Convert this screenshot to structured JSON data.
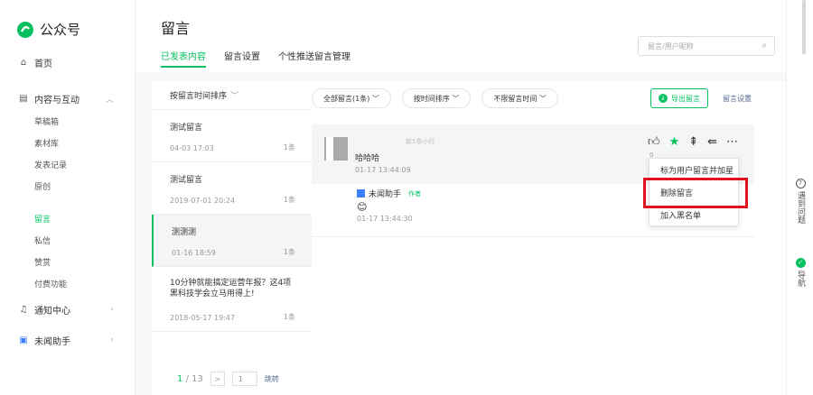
{
  "app": {
    "name": "公众号"
  },
  "sidebar": {
    "home": "首页",
    "content_group": "内容与互动",
    "content_items": [
      "草稿箱",
      "素材库",
      "发表记录",
      "原创"
    ],
    "interaction_items": [
      "留言",
      "私信",
      "赞赏",
      "付费功能"
    ],
    "notice": "通知中心",
    "assistant": "未闻助手"
  },
  "header": {
    "title": "留言",
    "tabs": [
      "已发表内容",
      "留言设置",
      "个性推送留言管理"
    ],
    "search_placeholder": "留言/用户昵称"
  },
  "list": {
    "sort_label": "按留言时间排序",
    "items": [
      {
        "title": "测试留言",
        "date": "04-03 17:03",
        "count": "1条"
      },
      {
        "title": "测试留言",
        "date": "2019-07-01 20:24",
        "count": "1条"
      },
      {
        "title": "测测测",
        "date": "01-16 18:59",
        "count": "1条"
      },
      {
        "title": "10分钟就能搞定运营年报？这4项黑科技学会立马用得上!",
        "date": "2018-05-17 19:47",
        "count": "1条"
      }
    ],
    "pager": {
      "current": "1",
      "total": "/ 13",
      "next": ">",
      "input": "1",
      "jump": "跳转"
    }
  },
  "detail": {
    "filters": [
      "全部留言(1条)",
      "按时间排序",
      "不限留言时间"
    ],
    "export": "导出留言",
    "settings": "留言设置",
    "comment": {
      "nickname": "新1条小行",
      "text": "哈哈哈",
      "time": "01-17 13:44:09",
      "zero": "0"
    },
    "reply": {
      "name": "未闻助手",
      "badge": "作者",
      "emoji": "😊",
      "time": "01-17 13:44:30"
    },
    "menu": [
      "标为用户留言并加星",
      "删除留言",
      "加入黑名单"
    ]
  },
  "rightbar": {
    "help": "遇到问题",
    "guide": "导航"
  },
  "colors": {
    "accent": "#07c160",
    "highlight": "#e0121d",
    "link": "#576b95"
  }
}
